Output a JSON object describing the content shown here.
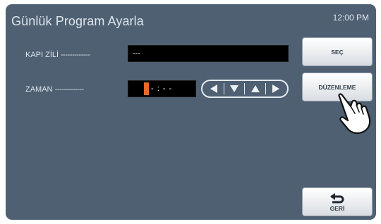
{
  "header": {
    "title": "Günlük Program Ayarla",
    "time": "12:00 PM"
  },
  "rows": {
    "door_bell": {
      "label": "KAPI ZİLİ",
      "dashes": "-------------",
      "value": "---"
    },
    "time": {
      "label": "ZAMAN",
      "dashes": "-------------",
      "value_rest": "- : - -"
    }
  },
  "arrows": [
    "left-arrow",
    "down-arrow",
    "up-arrow",
    "right-arrow"
  ],
  "buttons": {
    "select": "SEÇ",
    "edit": "DÜZENLEME",
    "back": "GERİ"
  },
  "colors": {
    "background": "#4e6072",
    "cursor": "#e8692a",
    "field": "#000000"
  }
}
